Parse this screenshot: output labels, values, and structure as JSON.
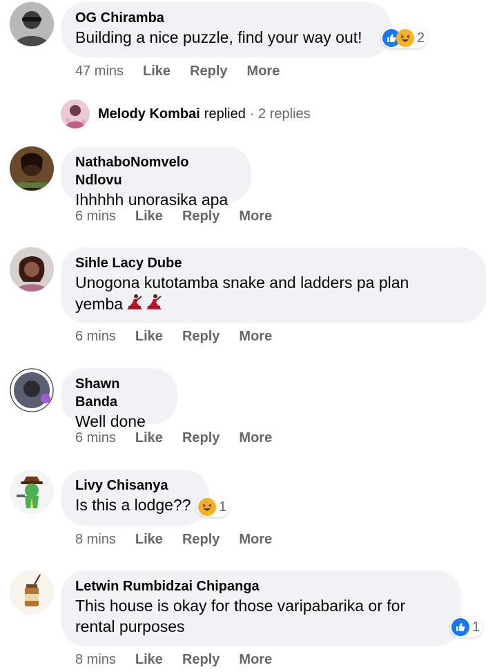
{
  "comments": [
    {
      "author": "OG Chiramba",
      "text": "Building a nice puzzle, find your way out!",
      "time": "47 mins",
      "like": "Like",
      "reply": "Reply",
      "more": "More",
      "reaction_icons": [
        "like-icon",
        "haha-icon"
      ],
      "reaction_count": "2"
    },
    {
      "author": "NathaboNomvelo Ndlovu",
      "text": "Ihhhhh unorasika apa",
      "time": "6 mins",
      "like": "Like",
      "reply": "Reply",
      "more": "More"
    },
    {
      "author": "Sihle Lacy Dube",
      "text_line1": "Unogona kutotamba snake and ladders pa plan",
      "text_line2": "yemba",
      "emojis": [
        "dancer-emoji",
        "dancer-emoji"
      ],
      "time": "6 mins",
      "like": "Like",
      "reply": "Reply",
      "more": "More"
    },
    {
      "author": "Shawn Banda",
      "text": "Well done",
      "time": "6 mins",
      "like": "Like",
      "reply": "Reply",
      "more": "More"
    },
    {
      "author": "Livy Chisanya",
      "text": "Is this a lodge??",
      "time": "8 mins",
      "like": "Like",
      "reply": "Reply",
      "more": "More",
      "reaction_icons": [
        "haha-icon"
      ],
      "reaction_count": "1"
    },
    {
      "author": "Letwin Rumbidzai Chipanga",
      "text_line1": "This house is okay for those varipabarika or for",
      "text_line2": "rental purposes",
      "time": "8 mins",
      "like": "Like",
      "reply": "Reply",
      "more": "More",
      "reaction_icons": [
        "like-icon"
      ],
      "reaction_count": "1"
    }
  ],
  "reply_thread": {
    "author": "Melody Kombai",
    "label": "replied",
    "count": "· 2 replies"
  },
  "colors": {
    "bubble": "#f0f2f5",
    "secondary_text": "#65676b",
    "like_blue": "#1877f2",
    "haha_yellow": "#f7b125"
  }
}
